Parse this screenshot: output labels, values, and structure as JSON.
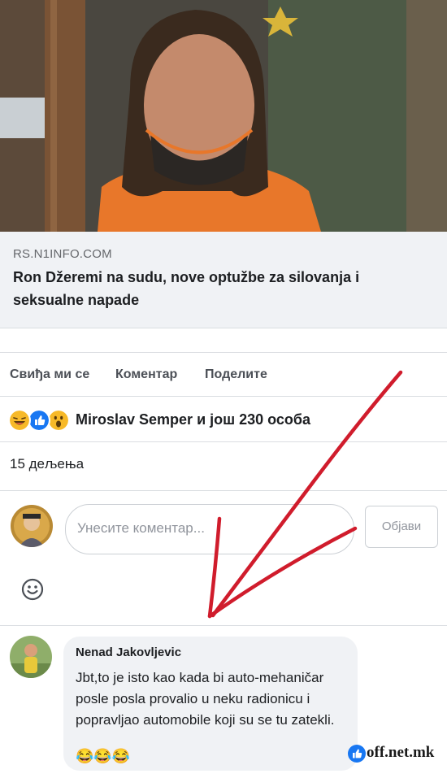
{
  "link_preview": {
    "domain": "RS.N1INFO.COM",
    "headline": "Ron Džeremi na sudu, nove optužbe za silovanja i seksualne napade"
  },
  "actions": {
    "like": "Свиђа ми се",
    "comment": "Коментар",
    "share": "Поделите"
  },
  "reactions": {
    "icons": [
      "laugh-reaction-icon",
      "like-reaction-icon",
      "wow-reaction-icon"
    ],
    "text": "Miroslav Semper и још 230 особа"
  },
  "shares": "15 дељења",
  "comment_input": {
    "placeholder": "Унесите коментар...",
    "post_label": "Објави"
  },
  "comment": {
    "author": "Nenad Jakovljevic",
    "text": "Jbt,to je isto kao kada bi auto-mehaničar posle posla provalio u neku radionicu i popravljao automobile koji su se tu zatekli.",
    "emoji": "😂😂😂"
  },
  "watermark": "off.net.mk",
  "colors": {
    "like_blue": "#1877f2",
    "link_bg": "#f0f2f5",
    "arrow_red": "#d01c2c"
  }
}
